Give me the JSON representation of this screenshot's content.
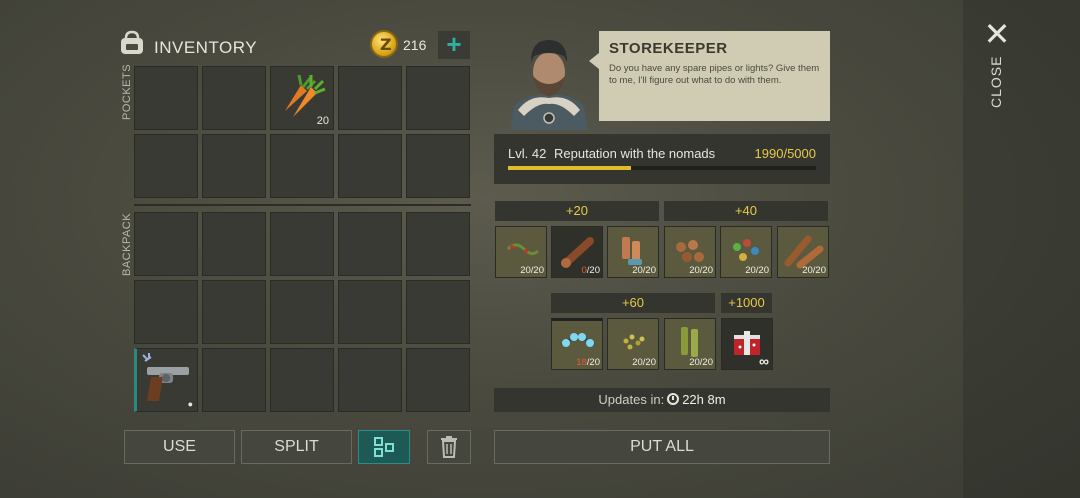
{
  "inventory": {
    "title": "INVENTORY",
    "coins": "216",
    "coin_symbol": "Z",
    "pockets_label": "POCKETS",
    "backpack_label": "BACKPACK",
    "carrot_qty": "20"
  },
  "buttons": {
    "use": "USE",
    "split": "SPLIT",
    "put_all": "PUT ALL"
  },
  "storekeeper": {
    "name": "STOREKEEPER",
    "text": "Do you have any spare pipes or lights? Give them to me, I'll figure out what to do with them."
  },
  "reputation": {
    "level": "Lvl. 42",
    "label": "Reputation with the nomads",
    "value": "1990/5000",
    "progress": 0.398
  },
  "tiers": {
    "t1": "+20",
    "t2": "+40",
    "t3": "+60",
    "t4": "+1000"
  },
  "trade_items": {
    "a": "20/20",
    "b_have": "0",
    "b_total": "/20",
    "c": "20/20",
    "d": "20/20",
    "e": "20/20",
    "f": "20/20",
    "g_have": "18",
    "g_total": "/20",
    "h": "20/20",
    "i": "20/20",
    "j": "∞"
  },
  "updates": {
    "label": "Updates in:",
    "time": "22h 8m"
  },
  "close_label": "CLOSE",
  "colors": {
    "accent_gold": "#e8c94a",
    "accent_teal": "#2fb0a0"
  }
}
